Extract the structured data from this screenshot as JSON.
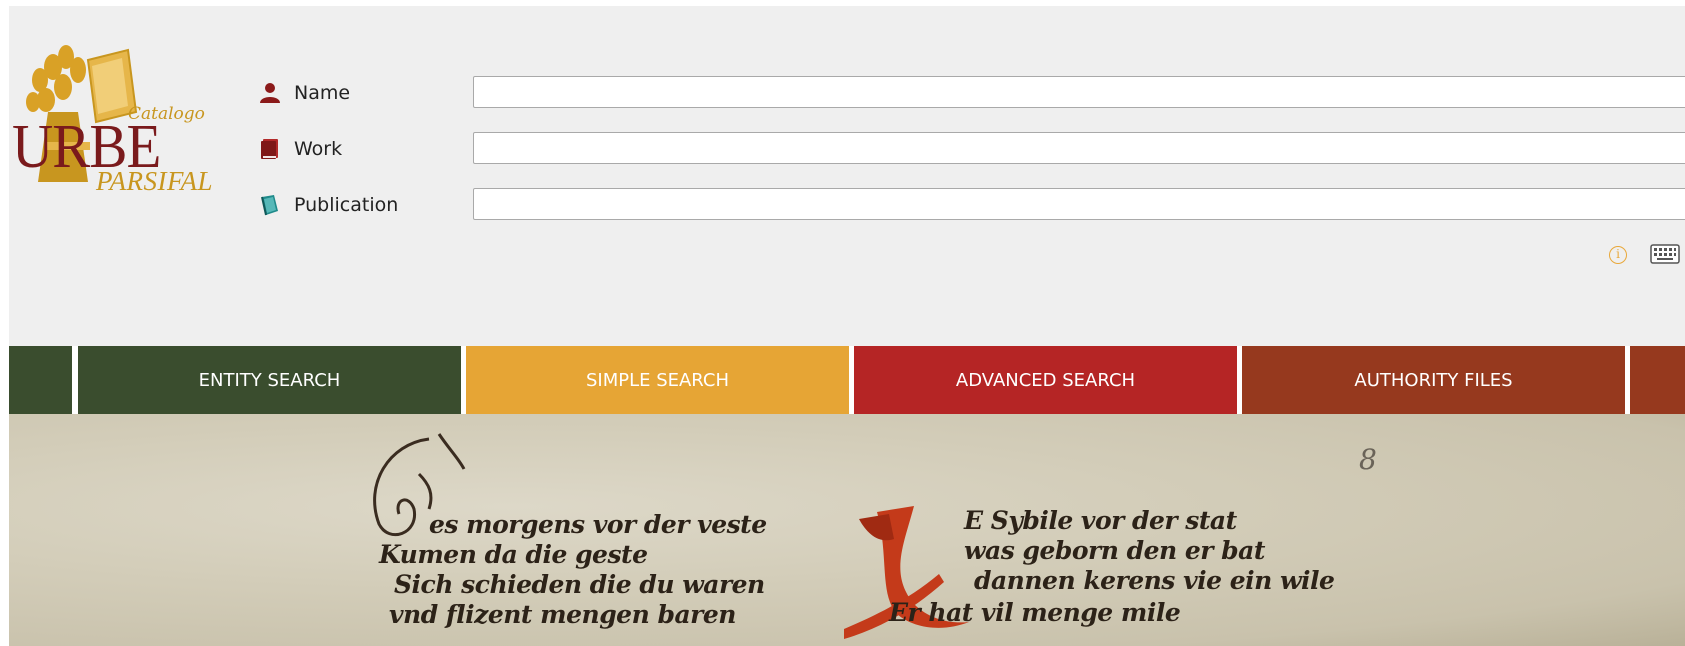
{
  "logo": {
    "catalogo": "Catalogo",
    "urbe": "URBE",
    "parsifal": "PARSIFAL"
  },
  "search_fields": [
    {
      "label": "Name",
      "icon": "person-icon",
      "value": "",
      "color": "#8b1a1a"
    },
    {
      "label": "Work",
      "icon": "book-icon",
      "value": "",
      "color": "#b22a2a"
    },
    {
      "label": "Publication",
      "icon": "publication-icon",
      "value": "",
      "color": "#1f8a8a"
    }
  ],
  "tools": {
    "info_icon": "info-icon",
    "keyboard_icon": "keyboard-icon"
  },
  "nav": {
    "tabs": [
      {
        "label": "",
        "color": "#3a4d2e"
      },
      {
        "label": "ENTITY SEARCH",
        "color": "#3a4d2e"
      },
      {
        "label": "SIMPLE SEARCH",
        "color": "#e6a535"
      },
      {
        "label": "ADVANCED SEARCH",
        "color": "#b52525"
      },
      {
        "label": "AUTHORITY FILES",
        "color": "#96391e"
      },
      {
        "label": "",
        "color": "#96391e"
      }
    ]
  },
  "manuscript": {
    "folio_number": "8",
    "left_column": [
      "es morgens vor der veste",
      "Kumen da die geste",
      "Sich schieden die du waren",
      "vnd flizent mengen baren"
    ],
    "right_column": [
      "E Sybile vor der stat",
      "was geborn den er bat",
      "dannen kerens vie ein wile",
      "Er hat vil menge mile"
    ]
  }
}
